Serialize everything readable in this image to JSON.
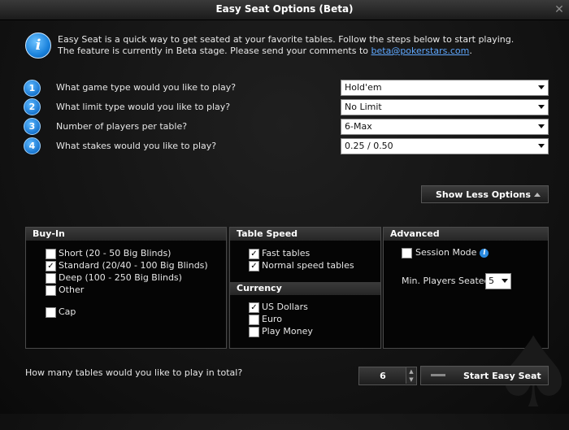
{
  "window": {
    "title": "Easy Seat Options (Beta)"
  },
  "intro": {
    "line1": "Easy Seat is a quick way to get seated at your favorite tables. Follow the steps below to start playing.",
    "line2_prefix": "The feature is currently in Beta stage. Please send your comments to ",
    "email": "beta@pokerstars.com",
    "line2_suffix": "."
  },
  "steps": [
    {
      "num": "1",
      "question": "What game type would you like to play?",
      "value": "Hold'em"
    },
    {
      "num": "2",
      "question": "What limit type would you like to play?",
      "value": "No Limit"
    },
    {
      "num": "3",
      "question": "Number of players per table?",
      "value": "6-Max"
    },
    {
      "num": "4",
      "question": "What stakes would you like to play?",
      "value": "0.25 / 0.50"
    }
  ],
  "options_button": {
    "label": "Show Less Options"
  },
  "buyin": {
    "header": "Buy-In",
    "options": [
      {
        "label": "Short (20 - 50 Big Blinds)",
        "checked": false
      },
      {
        "label": "Standard (20/40 - 100 Big Blinds)",
        "checked": true
      },
      {
        "label": "Deep (100 - 250 Big Blinds)",
        "checked": false
      },
      {
        "label": "Other",
        "checked": false
      }
    ],
    "cap": {
      "label": "Cap",
      "checked": false
    }
  },
  "table_speed": {
    "header": "Table Speed",
    "options": [
      {
        "label": "Fast tables",
        "checked": true
      },
      {
        "label": "Normal speed tables",
        "checked": true
      }
    ]
  },
  "currency": {
    "header": "Currency",
    "options": [
      {
        "label": "US Dollars",
        "checked": true
      },
      {
        "label": "Euro",
        "checked": false
      },
      {
        "label": "Play Money",
        "checked": false
      }
    ]
  },
  "advanced": {
    "header": "Advanced",
    "session_mode": {
      "label": "Session Mode",
      "checked": false
    },
    "min_players_label": "Min. Players Seated:",
    "min_players_value": "5"
  },
  "bottom": {
    "tables_question": "How many tables would you like to play in total?",
    "tables_value": "6",
    "start_button": "Start Easy Seat"
  }
}
